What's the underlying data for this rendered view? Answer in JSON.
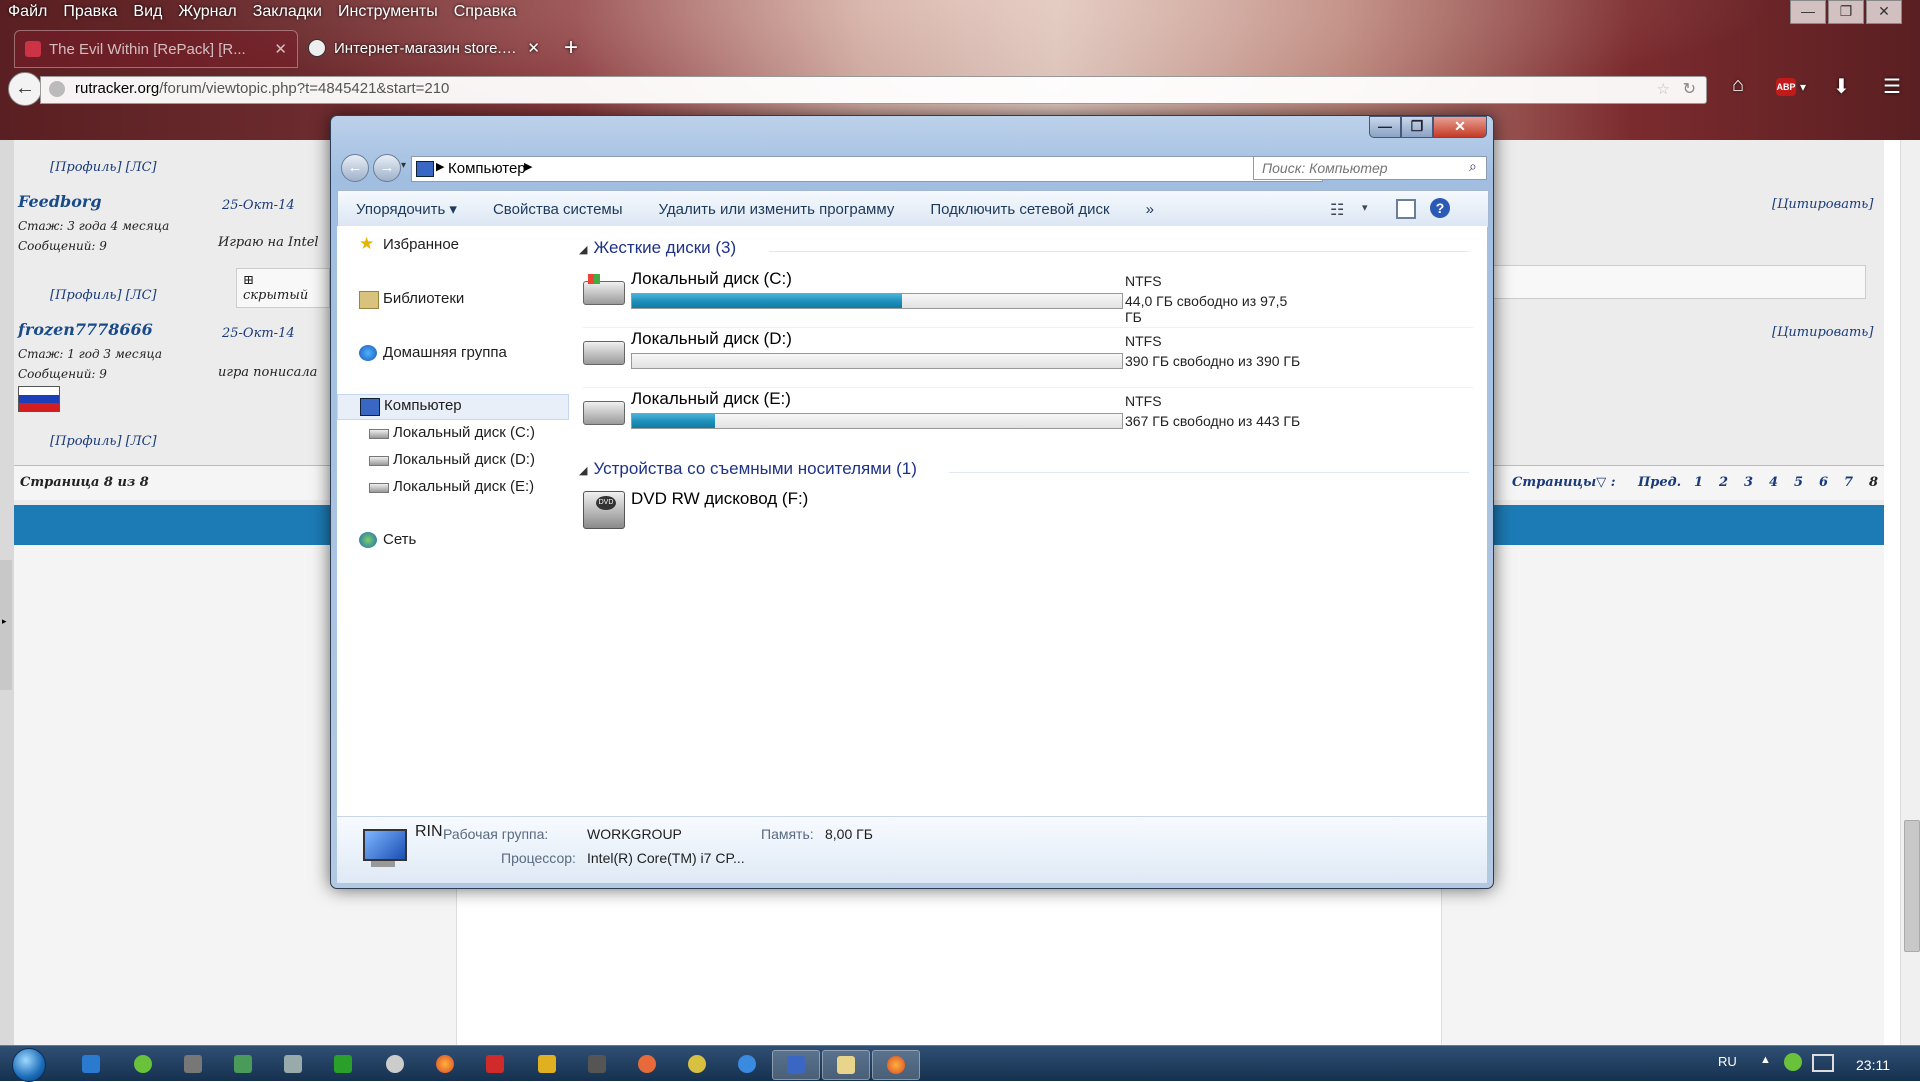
{
  "browser": {
    "menu": [
      "Файл",
      "Правка",
      "Вид",
      "Журнал",
      "Закладки",
      "Инструменты",
      "Справка"
    ],
    "window_controls": [
      "—",
      "❐",
      "✕"
    ],
    "tabs": [
      {
        "label": "The Evil Within [RePack] [R...",
        "close": "✕"
      },
      {
        "label": "Интернет-магазин store.o...",
        "close": "✕"
      }
    ],
    "new_tab": "+",
    "url_host": "rutracker.org",
    "url_path": "/forum/viewtopic.php?t=4845421&start=210",
    "abp": "ABP"
  },
  "forum": {
    "profile_links": "[Профиль]  [ЛС]",
    "posts": [
      {
        "author": "Feedborg",
        "stazh": "Стаж: 3 года 4 месяца",
        "msgs": "Сообщений: 9",
        "date": "25-Окт-14",
        "text": "Играю на Intel",
        "spoiler": "⊞ скрытый",
        "quote": "[Цитировать]"
      },
      {
        "author": "frozen7778666",
        "stazh": "Стаж: 1 год 3 месяца",
        "msgs": "Сообщений: 9",
        "date": "25-Окт-14",
        "text": "игра понисала",
        "quote": "[Цитировать]"
      }
    ],
    "page_label": "Страница 8 из 8",
    "pages_label": "Страницы▽ :",
    "prev": "Пред.",
    "page_numbers": [
      "1",
      "2",
      "3",
      "4",
      "5",
      "6",
      "7",
      "8"
    ]
  },
  "explorer": {
    "controls": {
      "min": "—",
      "max": "❐",
      "close": "✕"
    },
    "breadcrumb": "Компьютер",
    "search_placeholder": "Поиск: Компьютер",
    "commands": [
      "Упорядочить ▾",
      "Свойства системы",
      "Удалить или изменить программу",
      "Подключить сетевой диск",
      "»"
    ],
    "nav": {
      "favorites": "Избранное",
      "libraries": "Библиотеки",
      "homegroup": "Домашняя группа",
      "computer": "Компьютер",
      "drive_c": "Локальный диск (C:)",
      "drive_d": "Локальный диск (D:)",
      "drive_e": "Локальный диск (E:)",
      "network": "Сеть"
    },
    "group_hdd": "Жесткие диски (3)",
    "group_removable": "Устройства со съемными носителями (1)",
    "drives": [
      {
        "name": "Локальный диск (C:)",
        "fs": "NTFS",
        "free": "44,0 ГБ свободно из 97,5 ГБ",
        "used_fraction": 0.55
      },
      {
        "name": "Локальный диск (D:)",
        "fs": "NTFS",
        "free": "390 ГБ свободно из 390 ГБ",
        "used_fraction": 0.0
      },
      {
        "name": "Локальный диск (E:)",
        "fs": "NTFS",
        "free": "367 ГБ свободно из 443 ГБ",
        "used_fraction": 0.17
      }
    ],
    "dvd": "DVD RW дисковод (F:)",
    "details": {
      "name": "RIN",
      "workgroup_label": "Рабочая группа:",
      "workgroup": "WORKGROUP",
      "memory_label": "Память:",
      "memory": "8,00 ГБ",
      "cpu_label": "Процессор:",
      "cpu": "Intel(R) Core(TM) i7 CP..."
    }
  },
  "taskbar": {
    "lang": "RU",
    "clock": "23:11",
    "up_arrow": "▲"
  },
  "colors": {
    "accent": "#1c7bb5",
    "drive_fill": "#1c8eb8",
    "group_text": "#1e3287"
  }
}
